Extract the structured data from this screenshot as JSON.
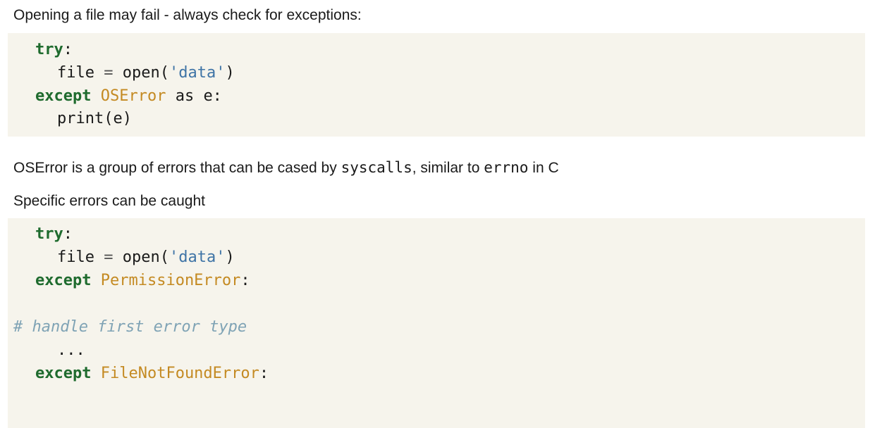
{
  "intro_text": "Opening a file may fail - always check for exceptions:",
  "block1": {
    "line1_kw": "try",
    "line1_colon": ":",
    "line2_name": "file",
    "line2_eq": "=",
    "line2_fn": "open(",
    "line2_str": "'data'",
    "line2_close": ")",
    "line3_kw": "except",
    "line3_cls": "OSError",
    "line3_rest": "as e:",
    "line4_text": "print(e)"
  },
  "para2": {
    "part1": "OSError is a group of errors that can be cased by ",
    "code1": "syscalls",
    "part2": ", similar to ",
    "code2": "errno",
    "part3": " in C"
  },
  "para3_text": "Specific errors can be caught",
  "block2": {
    "line1_kw": "try",
    "line1_colon": ":",
    "line2_name": "file",
    "line2_eq": "=",
    "line2_fn": "open(",
    "line2_str": "'data'",
    "line2_close": ")",
    "line3_kw": "except",
    "line3_cls": "PermissionError",
    "line3_colon": ":",
    "comment": "# handle first error type",
    "ellipsis": "...",
    "line6_kw": "except",
    "line6_cls": "FileNotFoundError",
    "line6_colon": ":"
  }
}
